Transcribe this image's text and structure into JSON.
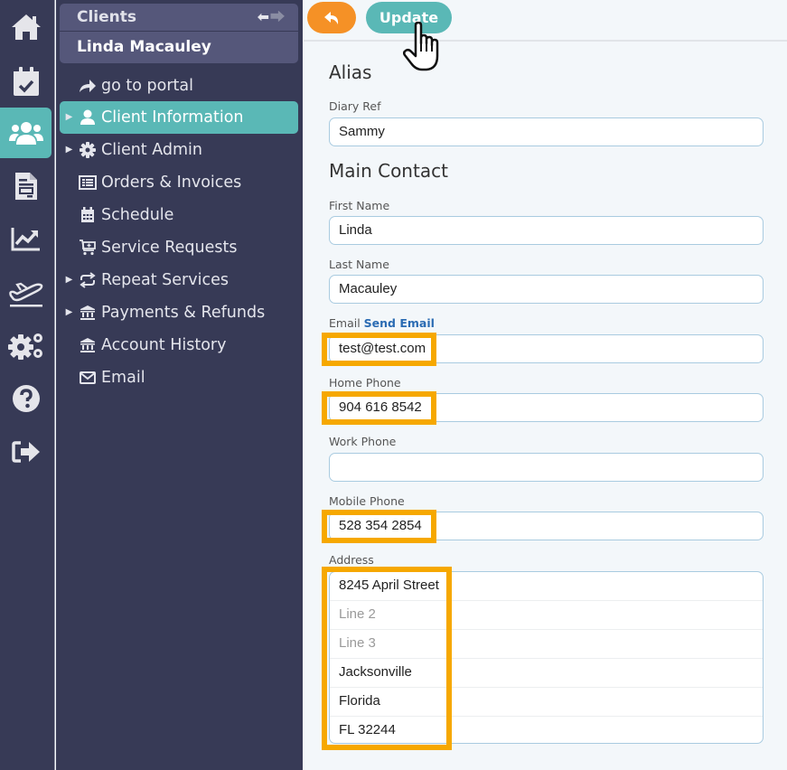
{
  "rail": {
    "items": [
      {
        "icon": "home-icon",
        "active": false
      },
      {
        "icon": "calendar-check-icon",
        "active": false
      },
      {
        "icon": "users-icon",
        "active": true
      },
      {
        "icon": "document-icon",
        "active": false
      },
      {
        "icon": "chart-line-icon",
        "active": false
      },
      {
        "icon": "plane-departure-icon",
        "active": false
      },
      {
        "icon": "cogs-icon",
        "active": false
      },
      {
        "icon": "help-icon",
        "active": false
      },
      {
        "icon": "sign-out-icon",
        "active": false
      }
    ]
  },
  "sidenav": {
    "breadcrumb": "Clients",
    "back_arrow": "🡐",
    "forward_arrow": "🡒",
    "client_name": "Linda Macauley",
    "items": [
      {
        "label": "go to portal",
        "icon": "share-icon",
        "caret": false,
        "active": false
      },
      {
        "label": "Client Information",
        "icon": "user-icon",
        "caret": true,
        "active": true
      },
      {
        "label": "Client Admin",
        "icon": "gear-icon",
        "caret": true,
        "active": false
      },
      {
        "label": "Orders & Invoices",
        "icon": "list-alt-icon",
        "caret": false,
        "active": false
      },
      {
        "label": "Schedule",
        "icon": "calendar-icon",
        "caret": false,
        "active": false
      },
      {
        "label": "Service Requests",
        "icon": "cart-plus-icon",
        "caret": false,
        "active": false
      },
      {
        "label": "Repeat Services",
        "icon": "repeat-icon",
        "caret": true,
        "active": false
      },
      {
        "label": "Payments & Refunds",
        "icon": "bank-icon",
        "caret": true,
        "active": false
      },
      {
        "label": "Account History",
        "icon": "bank-icon",
        "caret": false,
        "active": false
      },
      {
        "label": "Email",
        "icon": "envelope-icon",
        "caret": false,
        "active": false
      }
    ]
  },
  "toolbar": {
    "back_icon": "reply-icon",
    "update_label": "Update"
  },
  "form": {
    "alias_title": "Alias",
    "diary_ref_label": "Diary Ref",
    "diary_ref_value": "Sammy",
    "main_contact_title": "Main Contact",
    "first_name_label": "First Name",
    "first_name_value": "Linda",
    "last_name_label": "Last Name",
    "last_name_value": "Macauley",
    "email_label": "Email",
    "send_email_link": "Send Email",
    "email_value": "test@test.com",
    "home_phone_label": "Home Phone",
    "home_phone_value": "904 616 8542",
    "work_phone_label": "Work Phone",
    "work_phone_value": "",
    "mobile_phone_label": "Mobile Phone",
    "mobile_phone_value": "528 354 2854",
    "address_label": "Address",
    "address_lines": [
      {
        "value": "8245 April Street",
        "placeholder": false
      },
      {
        "value": "Line 2",
        "placeholder": true
      },
      {
        "value": "Line 3",
        "placeholder": true
      },
      {
        "value": "Jacksonville",
        "placeholder": false
      },
      {
        "value": "Florida",
        "placeholder": false
      },
      {
        "value": "FL 32244",
        "placeholder": false
      }
    ]
  },
  "colors": {
    "sidebar_bg": "#373a56",
    "accent_teal": "#5ab8b6",
    "back_button_orange": "#f59126",
    "highlight_orange": "#f6a800",
    "link_blue": "#2a6bb3"
  }
}
